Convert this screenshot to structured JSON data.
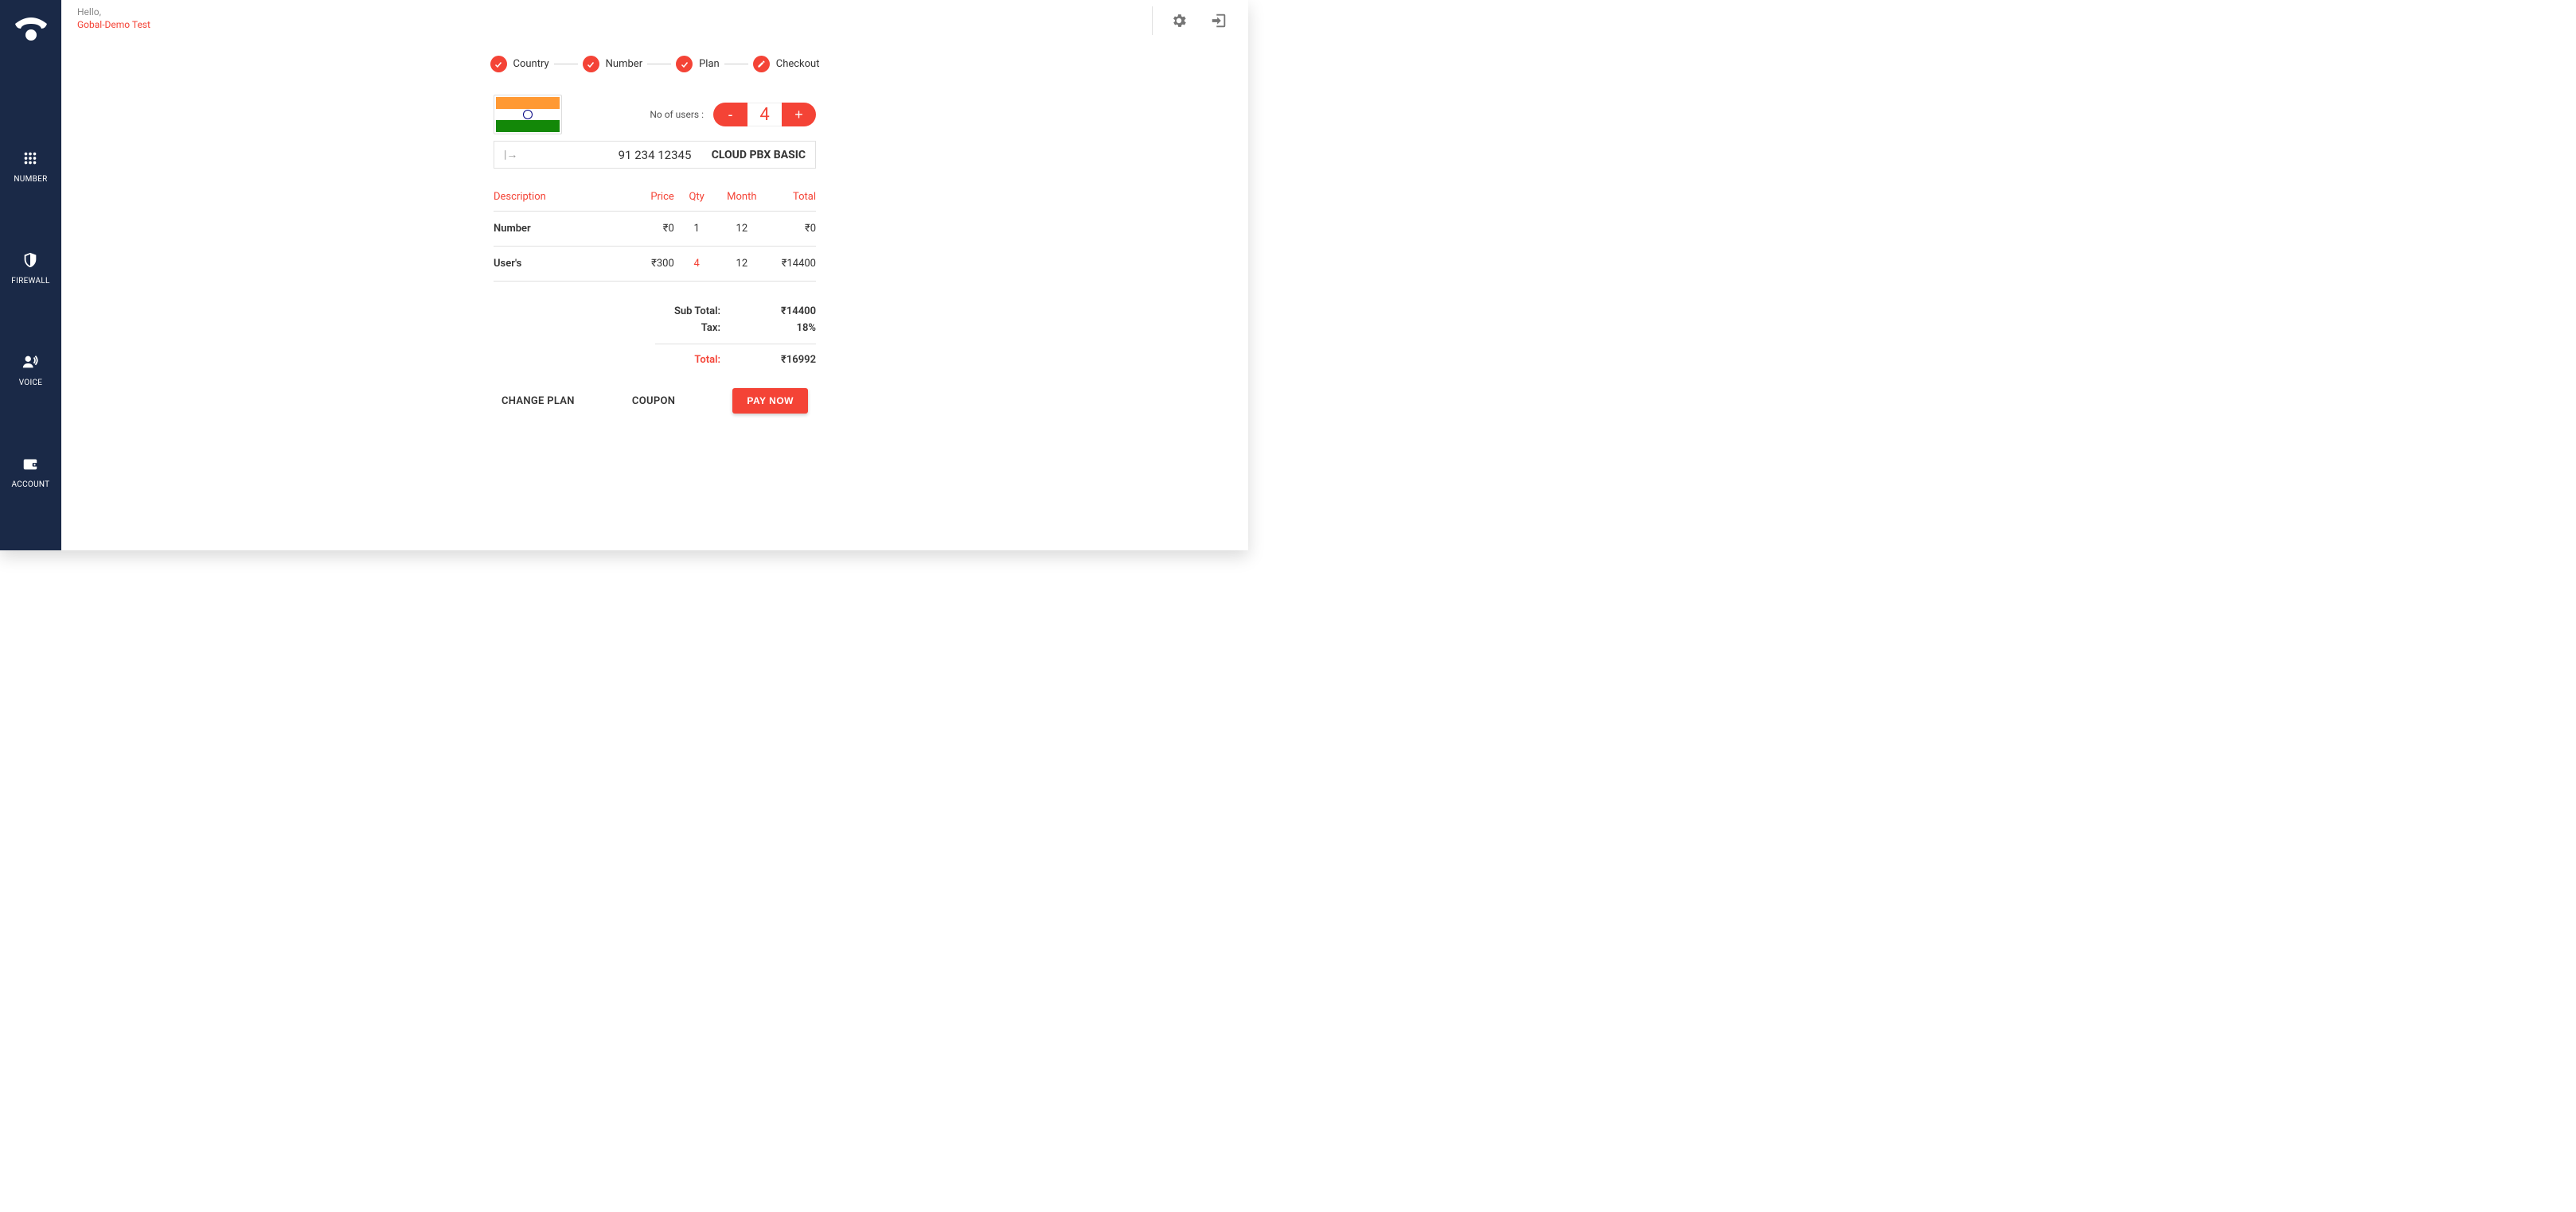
{
  "header": {
    "greeting": "Hello,",
    "username": "Gobal-Demo Test"
  },
  "sidebar": {
    "items": [
      {
        "label": "NUMBER",
        "icon": "dialpad"
      },
      {
        "label": "FIREWALL",
        "icon": "shield"
      },
      {
        "label": "VOICE",
        "icon": "voice"
      },
      {
        "label": "ACCOUNT",
        "icon": "wallet"
      }
    ]
  },
  "stepper": {
    "steps": [
      {
        "label": "Country",
        "icon": "check"
      },
      {
        "label": "Number",
        "icon": "check"
      },
      {
        "label": "Plan",
        "icon": "check"
      },
      {
        "label": "Checkout",
        "icon": "edit"
      }
    ]
  },
  "checkout": {
    "users_label": "No of users :",
    "users_value": "4",
    "minus": "-",
    "plus": "+",
    "phone_number": "91 234 12345",
    "plan_name": "CLOUD PBX BASIC",
    "table": {
      "headers": {
        "description": "Description",
        "price": "Price",
        "qty": "Qty",
        "month": "Month",
        "total": "Total"
      },
      "rows": [
        {
          "description": "Number",
          "price": "₹0",
          "qty": "1",
          "month": "12",
          "total": "₹0",
          "qty_highlight": false
        },
        {
          "description": "User's",
          "price": "₹300",
          "qty": "4",
          "month": "12",
          "total": "₹14400",
          "qty_highlight": true
        }
      ]
    },
    "summary": {
      "subtotal_label": "Sub Total:",
      "subtotal_value": "₹14400",
      "tax_label": "Tax:",
      "tax_value": "18%",
      "total_label": "Total:",
      "total_value": "₹16992"
    },
    "actions": {
      "change_plan": "CHANGE PLAN",
      "coupon": "COUPON",
      "pay_now": "PAY NOW"
    }
  }
}
